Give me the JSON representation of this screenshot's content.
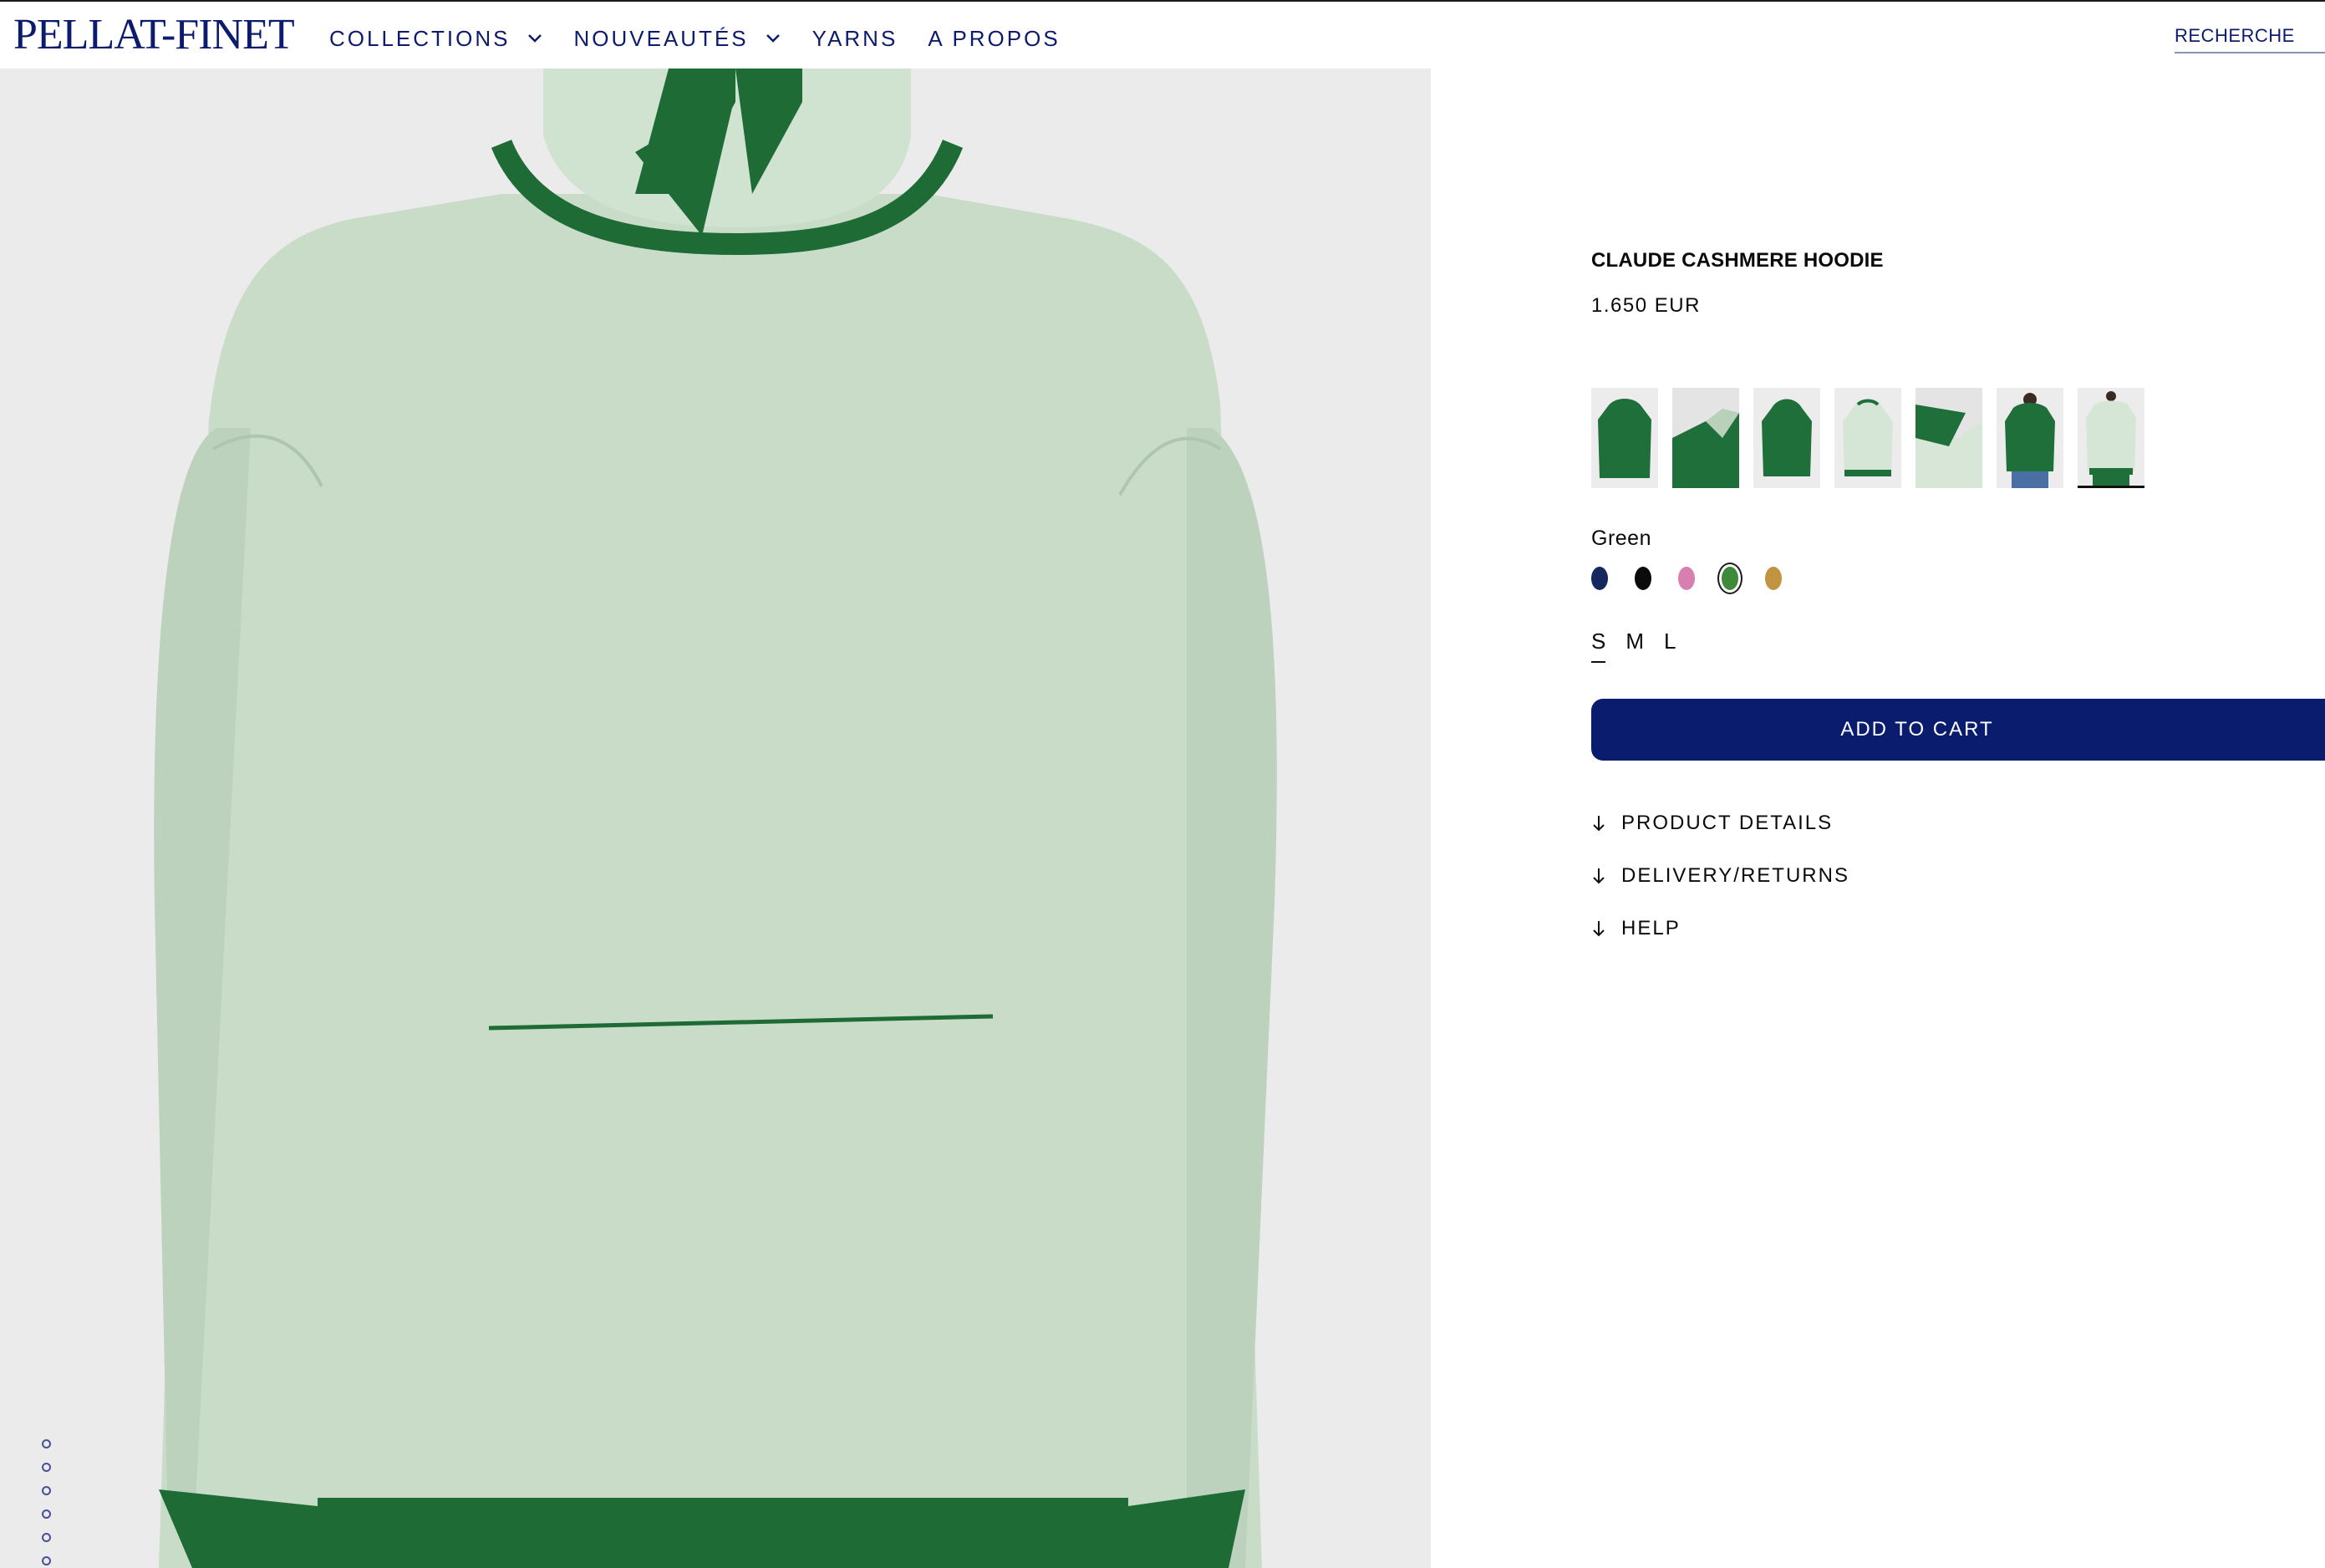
{
  "brand": {
    "logo_text": "PELLAT-FINET",
    "accent": "#0d1b6e"
  },
  "nav": {
    "items": [
      {
        "label": "COLLECTIONS",
        "has_dropdown": true
      },
      {
        "label": "NOUVEAUTÉS",
        "has_dropdown": true
      },
      {
        "label": "YARNS",
        "has_dropdown": false
      },
      {
        "label": "A PROPOS",
        "has_dropdown": false
      }
    ],
    "search_label": "RECHERCHE"
  },
  "gallery": {
    "image_count": 7,
    "active_index": 6
  },
  "product": {
    "title": "CLAUDE CASHMERE HOODIE",
    "price": "1.650 EUR",
    "color_label": "Green",
    "swatches": [
      {
        "name": "navy",
        "color": "#14285e"
      },
      {
        "name": "black",
        "color": "#0b0b0b"
      },
      {
        "name": "pink",
        "color": "#d77fb0"
      },
      {
        "name": "green",
        "color": "#3f8a3a",
        "selected": true
      },
      {
        "name": "camel",
        "color": "#c09440"
      }
    ],
    "sizes": [
      {
        "label": "S",
        "selected": true
      },
      {
        "label": "M",
        "selected": false
      },
      {
        "label": "L",
        "selected": false
      }
    ],
    "add_to_cart_label": "ADD TO CART",
    "accordion": [
      {
        "label": "PRODUCT DETAILS"
      },
      {
        "label": "DELIVERY/RETURNS"
      },
      {
        "label": "HELP"
      }
    ]
  }
}
